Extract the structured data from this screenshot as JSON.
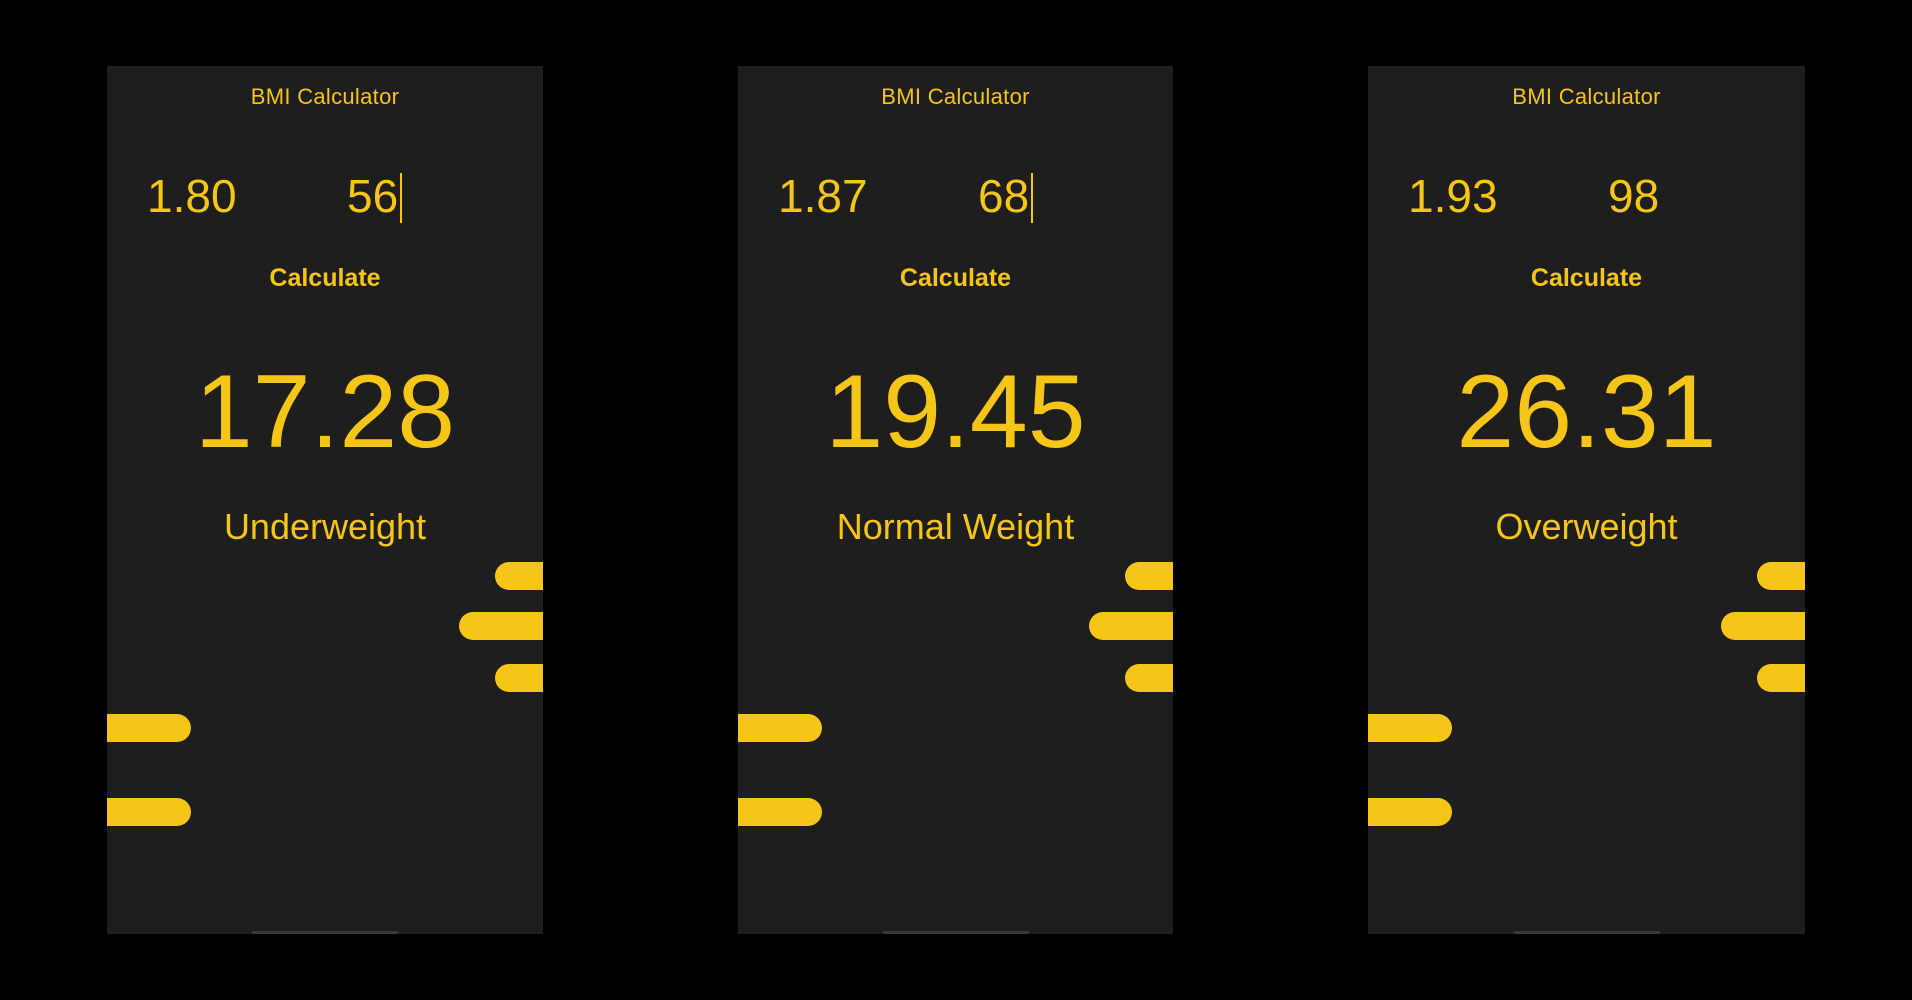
{
  "accent_color": "#f5c518",
  "background_color": "#000000",
  "screen_color": "#1e1e1e",
  "screens": [
    {
      "title": "BMI Calculator",
      "height_value": "1.80",
      "weight_value": "56",
      "calculate_label": "Calculate",
      "bmi_result": "17.28",
      "category": "Underweight"
    },
    {
      "title": "BMI Calculator",
      "height_value": "1.87",
      "weight_value": "68",
      "calculate_label": "Calculate",
      "bmi_result": "19.45",
      "category": "Normal Weight"
    },
    {
      "title": "BMI Calculator",
      "height_value": "1.93",
      "weight_value": "98",
      "calculate_label": "Calculate",
      "bmi_result": "26.31",
      "category": "Overweight"
    }
  ]
}
